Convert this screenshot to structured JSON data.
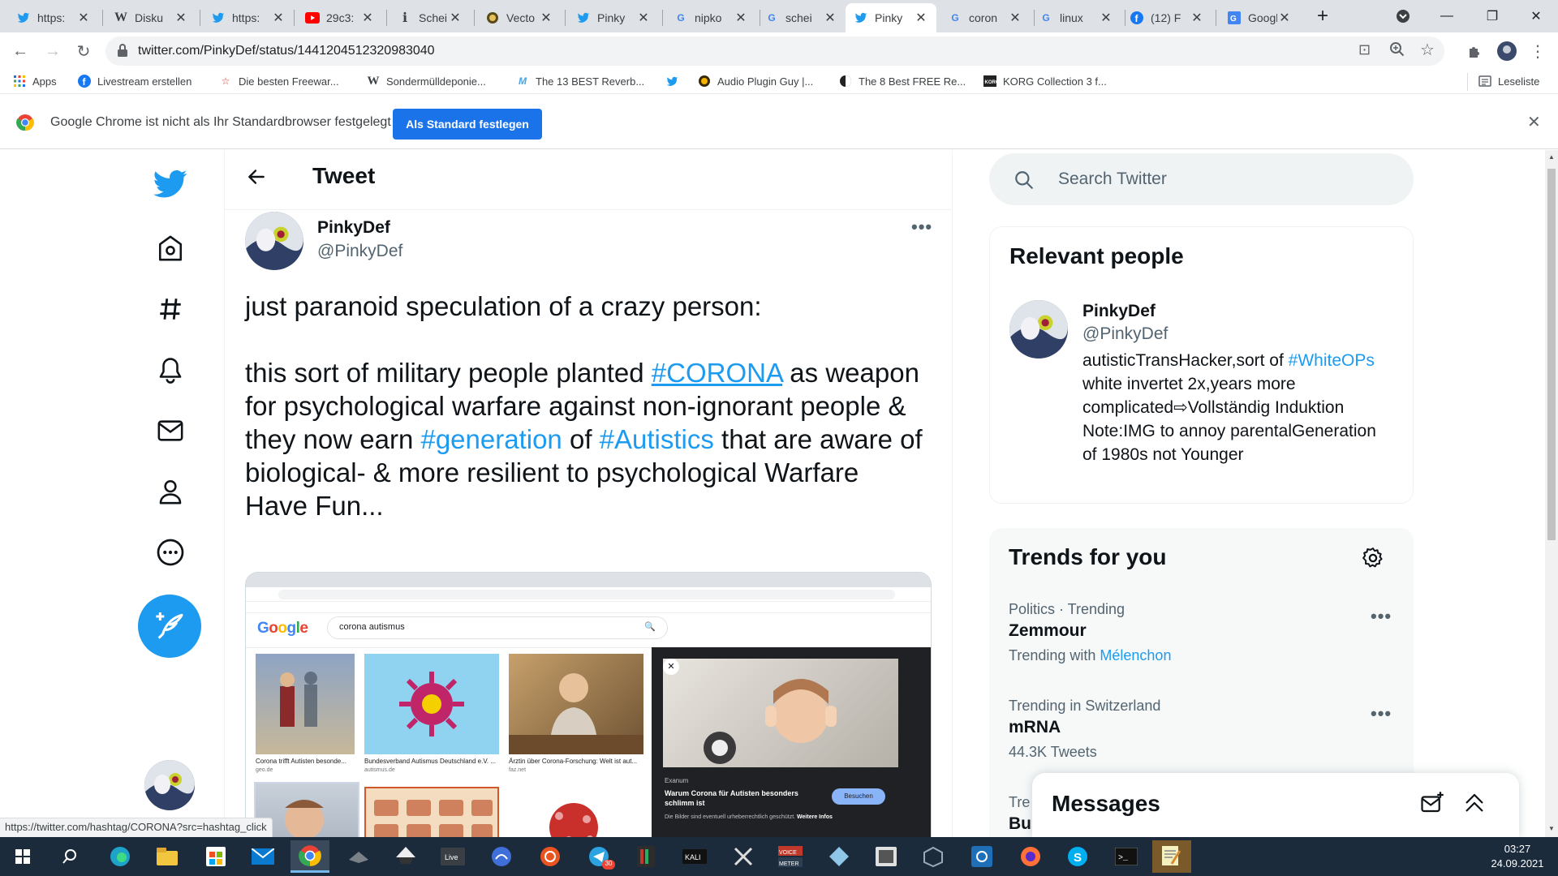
{
  "browser": {
    "tabs": [
      {
        "label": "https:",
        "icon": "twitter-icon"
      },
      {
        "label": "Disku",
        "icon": "wikipedia-icon"
      },
      {
        "label": "https:",
        "icon": "twitter-icon"
      },
      {
        "label": "29c3:",
        "icon": "youtube-icon"
      },
      {
        "label": "Schei",
        "icon": "page-icon"
      },
      {
        "label": "Vecto",
        "icon": "page-icon"
      },
      {
        "label": "Pinky",
        "icon": "twitter-icon"
      },
      {
        "label": "nipko",
        "icon": "google-icon"
      },
      {
        "label": "schei",
        "icon": "google-icon"
      },
      {
        "label": "Pinky",
        "icon": "twitter-icon"
      },
      {
        "label": "coron",
        "icon": "google-icon"
      },
      {
        "label": "linux",
        "icon": "google-icon"
      },
      {
        "label": "(12) F",
        "icon": "facebook-icon"
      },
      {
        "label": "Googl",
        "icon": "google-translate-icon"
      }
    ],
    "url": "twitter.com/PinkyDef/status/1441204512320983040",
    "bookmarks": [
      {
        "label": "Apps"
      },
      {
        "label": "Livestream erstellen"
      },
      {
        "label": "Die besten Freewar..."
      },
      {
        "label": "Sondermülldeponie..."
      },
      {
        "label": "The 13 BEST Reverb..."
      },
      {
        "label": ""
      },
      {
        "label": "Audio Plugin Guy |..."
      },
      {
        "label": "The 8 Best FREE Re..."
      },
      {
        "label": "KORG Collection 3 f..."
      }
    ],
    "reading_list": "Leseliste",
    "infobar_text": "Google Chrome ist nicht als Ihr Standardbrowser festgelegt",
    "infobar_button": "Als Standard festlegen",
    "status_url": "https://twitter.com/hashtag/CORONA?src=hashtag_click"
  },
  "twitter": {
    "header_title": "Tweet",
    "author_name": "PinkyDef",
    "author_handle": "@PinkyDef",
    "tweet_line1": "just paranoid speculation of a crazy person:",
    "tweet_p2_a": "this sort of military people planted ",
    "tag_corona": "#CORONA",
    "tweet_p2_b": " as weapon for psychological warfare against non-ignorant people & they now earn ",
    "tag_generation": "#generation",
    "tweet_p2_c": " of ",
    "tag_autistics": "#Autistics",
    "tweet_p2_d": " that are aware of biological- & more resilient to psychological Warfare",
    "tweet_p3": "Have Fun...",
    "search_placeholder": "Search Twitter",
    "relevant_title": "Relevant people",
    "relevant_name": "PinkyDef",
    "relevant_handle": "@PinkyDef",
    "bio_a": "autisticTransHacker,sort of ",
    "bio_tag": "#WhiteOPs",
    "bio_b": " white invertet 2x,years more complicated⇨Vollständig Induktion Note:IMG to annoy parentalGeneration of 1980s not Younger",
    "trends_title": "Trends for you",
    "trends": [
      {
        "meta": "Politics · Trending",
        "name": "Zemmour",
        "sub_prefix": "Trending with ",
        "sub_link": "Mélenchon"
      },
      {
        "meta": "Trending in Switzerland",
        "name": "mRNA",
        "sub_prefix": "44.3K Tweets",
        "sub_link": ""
      },
      {
        "meta": "Tre",
        "name": "Bu",
        "sub_prefix": "",
        "sub_link": ""
      }
    ],
    "messages_title": "Messages",
    "embed": {
      "search_query": "corona autismus",
      "captions": [
        "Corona trifft Autisten besonde...",
        "Bundesverband Autismus Deutschland e.V. ...",
        "Ärztin über Corona-Forschung: Welt ist aut...",
        "Warum Corona für Autisten besonders schlimm ist",
        "Besuchen",
        "Die Bilder sind eventuell urheberrechtlich geschützt.",
        "Weitere Infos"
      ],
      "sources": [
        "geo.de",
        "autismus.de",
        "faz.net",
        "Exanum"
      ]
    }
  },
  "taskbar": {
    "time": "03:27",
    "date": "24.09.2021"
  },
  "colors": {
    "twitter_blue": "#1d9bf0",
    "chrome_blue": "#1a73e8",
    "taskbar": "#1c2b3c"
  }
}
